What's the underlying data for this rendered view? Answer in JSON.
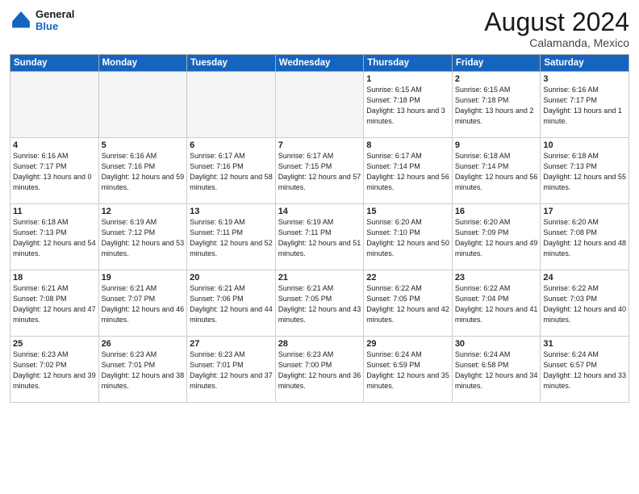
{
  "logo": {
    "general": "General",
    "blue": "Blue"
  },
  "title": {
    "month_year": "August 2024",
    "location": "Calamanda, Mexico"
  },
  "weekdays": [
    "Sunday",
    "Monday",
    "Tuesday",
    "Wednesday",
    "Thursday",
    "Friday",
    "Saturday"
  ],
  "weeks": [
    [
      {
        "day": "",
        "empty": true
      },
      {
        "day": "",
        "empty": true
      },
      {
        "day": "",
        "empty": true
      },
      {
        "day": "",
        "empty": true
      },
      {
        "day": "1",
        "sunrise": "6:15 AM",
        "sunset": "7:18 PM",
        "daylight": "13 hours and 3 minutes."
      },
      {
        "day": "2",
        "sunrise": "6:15 AM",
        "sunset": "7:18 PM",
        "daylight": "13 hours and 2 minutes."
      },
      {
        "day": "3",
        "sunrise": "6:16 AM",
        "sunset": "7:17 PM",
        "daylight": "13 hours and 1 minute."
      }
    ],
    [
      {
        "day": "4",
        "sunrise": "6:16 AM",
        "sunset": "7:17 PM",
        "daylight": "13 hours and 0 minutes."
      },
      {
        "day": "5",
        "sunrise": "6:16 AM",
        "sunset": "7:16 PM",
        "daylight": "12 hours and 59 minutes."
      },
      {
        "day": "6",
        "sunrise": "6:17 AM",
        "sunset": "7:16 PM",
        "daylight": "12 hours and 58 minutes."
      },
      {
        "day": "7",
        "sunrise": "6:17 AM",
        "sunset": "7:15 PM",
        "daylight": "12 hours and 57 minutes."
      },
      {
        "day": "8",
        "sunrise": "6:17 AM",
        "sunset": "7:14 PM",
        "daylight": "12 hours and 56 minutes."
      },
      {
        "day": "9",
        "sunrise": "6:18 AM",
        "sunset": "7:14 PM",
        "daylight": "12 hours and 56 minutes."
      },
      {
        "day": "10",
        "sunrise": "6:18 AM",
        "sunset": "7:13 PM",
        "daylight": "12 hours and 55 minutes."
      }
    ],
    [
      {
        "day": "11",
        "sunrise": "6:18 AM",
        "sunset": "7:13 PM",
        "daylight": "12 hours and 54 minutes."
      },
      {
        "day": "12",
        "sunrise": "6:19 AM",
        "sunset": "7:12 PM",
        "daylight": "12 hours and 53 minutes."
      },
      {
        "day": "13",
        "sunrise": "6:19 AM",
        "sunset": "7:11 PM",
        "daylight": "12 hours and 52 minutes."
      },
      {
        "day": "14",
        "sunrise": "6:19 AM",
        "sunset": "7:11 PM",
        "daylight": "12 hours and 51 minutes."
      },
      {
        "day": "15",
        "sunrise": "6:20 AM",
        "sunset": "7:10 PM",
        "daylight": "12 hours and 50 minutes."
      },
      {
        "day": "16",
        "sunrise": "6:20 AM",
        "sunset": "7:09 PM",
        "daylight": "12 hours and 49 minutes."
      },
      {
        "day": "17",
        "sunrise": "6:20 AM",
        "sunset": "7:08 PM",
        "daylight": "12 hours and 48 minutes."
      }
    ],
    [
      {
        "day": "18",
        "sunrise": "6:21 AM",
        "sunset": "7:08 PM",
        "daylight": "12 hours and 47 minutes."
      },
      {
        "day": "19",
        "sunrise": "6:21 AM",
        "sunset": "7:07 PM",
        "daylight": "12 hours and 46 minutes."
      },
      {
        "day": "20",
        "sunrise": "6:21 AM",
        "sunset": "7:06 PM",
        "daylight": "12 hours and 44 minutes."
      },
      {
        "day": "21",
        "sunrise": "6:21 AM",
        "sunset": "7:05 PM",
        "daylight": "12 hours and 43 minutes."
      },
      {
        "day": "22",
        "sunrise": "6:22 AM",
        "sunset": "7:05 PM",
        "daylight": "12 hours and 42 minutes."
      },
      {
        "day": "23",
        "sunrise": "6:22 AM",
        "sunset": "7:04 PM",
        "daylight": "12 hours and 41 minutes."
      },
      {
        "day": "24",
        "sunrise": "6:22 AM",
        "sunset": "7:03 PM",
        "daylight": "12 hours and 40 minutes."
      }
    ],
    [
      {
        "day": "25",
        "sunrise": "6:23 AM",
        "sunset": "7:02 PM",
        "daylight": "12 hours and 39 minutes."
      },
      {
        "day": "26",
        "sunrise": "6:23 AM",
        "sunset": "7:01 PM",
        "daylight": "12 hours and 38 minutes."
      },
      {
        "day": "27",
        "sunrise": "6:23 AM",
        "sunset": "7:01 PM",
        "daylight": "12 hours and 37 minutes."
      },
      {
        "day": "28",
        "sunrise": "6:23 AM",
        "sunset": "7:00 PM",
        "daylight": "12 hours and 36 minutes."
      },
      {
        "day": "29",
        "sunrise": "6:24 AM",
        "sunset": "6:59 PM",
        "daylight": "12 hours and 35 minutes."
      },
      {
        "day": "30",
        "sunrise": "6:24 AM",
        "sunset": "6:58 PM",
        "daylight": "12 hours and 34 minutes."
      },
      {
        "day": "31",
        "sunrise": "6:24 AM",
        "sunset": "6:57 PM",
        "daylight": "12 hours and 33 minutes."
      }
    ]
  ],
  "labels": {
    "sunrise": "Sunrise:",
    "sunset": "Sunset:",
    "daylight": "Daylight:"
  }
}
